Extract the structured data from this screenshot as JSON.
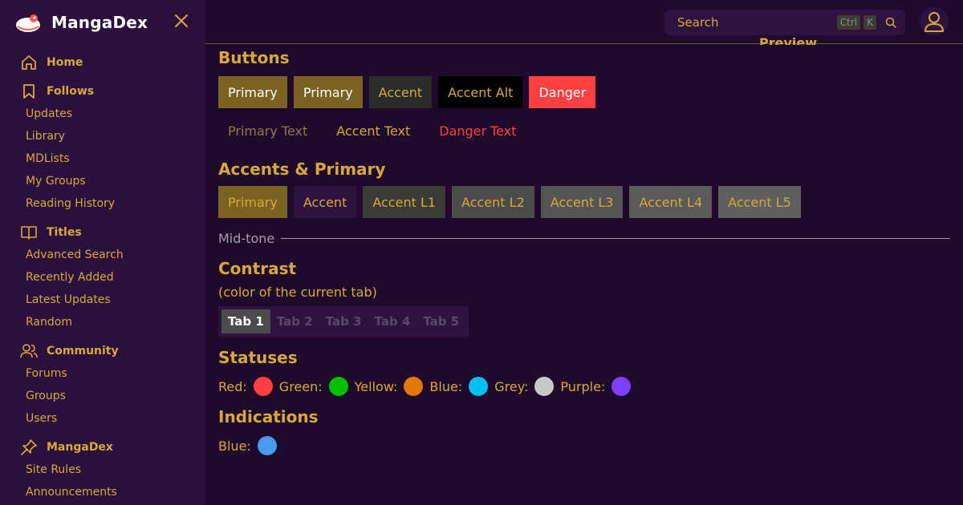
{
  "brand": {
    "name": "MangaDex"
  },
  "header": {
    "search_placeholder": "Search",
    "kbd1": "Ctrl",
    "kbd2": "K"
  },
  "preview_label": "Preview",
  "sidebar": {
    "sections": [
      {
        "label": "Home",
        "icon": "home-icon",
        "items": []
      },
      {
        "label": "Follows",
        "icon": "bookmark-icon",
        "items": [
          "Updates",
          "Library",
          "MDLists",
          "My Groups",
          "Reading History"
        ]
      },
      {
        "label": "Titles",
        "icon": "book-icon",
        "items": [
          "Advanced Search",
          "Recently Added",
          "Latest Updates",
          "Random"
        ]
      },
      {
        "label": "Community",
        "icon": "users-icon",
        "items": [
          "Forums",
          "Groups",
          "Users"
        ]
      },
      {
        "label": "MangaDex",
        "icon": "pin-icon",
        "items": [
          "Site Rules",
          "Announcements"
        ]
      }
    ]
  },
  "main": {
    "buttons_title": "Buttons",
    "buttons": [
      {
        "label": "Primary",
        "bg": "#7a6222",
        "color": "#ffffff"
      },
      {
        "label": "Primary",
        "bg": "#7a6222",
        "color": "#ffffff"
      },
      {
        "label": "Accent",
        "bg": "#2b2b2b",
        "color": "#d7a93a"
      },
      {
        "label": "Accent Alt",
        "bg": "#000000",
        "color": "#d7a93a"
      },
      {
        "label": "Danger",
        "bg": "#ff4040",
        "color": "#ffffff"
      }
    ],
    "text_buttons": [
      {
        "label": "Primary Text",
        "color": "#8f7a4d"
      },
      {
        "label": "Accent Text",
        "color": "#d7a93a"
      },
      {
        "label": "Danger Text",
        "color": "#ff4040"
      }
    ],
    "accents_title": "Accents & Primary",
    "accent_buttons": [
      {
        "label": "Primary",
        "bg": "#7a6222",
        "color": "#d7a93a"
      },
      {
        "label": "Accent",
        "bg": "#2e123f",
        "color": "#d7a93a"
      },
      {
        "label": "Accent L1",
        "bg": "#3a3a38",
        "color": "#d7a93a"
      },
      {
        "label": "Accent L2",
        "bg": "#4b4b4b",
        "color": "#d7a93a"
      },
      {
        "label": "Accent L3",
        "bg": "#555555",
        "color": "#d7a93a"
      },
      {
        "label": "Accent L4",
        "bg": "#5a5a5a",
        "color": "#d7a93a"
      },
      {
        "label": "Accent L5",
        "bg": "#5f5f5f",
        "color": "#d7a93a"
      }
    ],
    "midtone_label": "Mid-tone",
    "contrast_title": "Contrast",
    "contrast_sub": "(color of the current tab)",
    "tabs": [
      "Tab 1",
      "Tab 2",
      "Tab 3",
      "Tab 4",
      "Tab 5"
    ],
    "statuses_title": "Statuses",
    "statuses": [
      {
        "label": "Red:",
        "color": "#ff4040"
      },
      {
        "label": "Green:",
        "color": "#00c000"
      },
      {
        "label": "Yellow:",
        "color": "#e0780a"
      },
      {
        "label": "Blue:",
        "color": "#00c0f0"
      },
      {
        "label": "Grey:",
        "color": "#c8c8c8"
      },
      {
        "label": "Purple:",
        "color": "#7a40ff"
      }
    ],
    "indications_title": "Indications",
    "indications": [
      {
        "label": "Blue:",
        "color": "#4a9af0"
      }
    ]
  }
}
